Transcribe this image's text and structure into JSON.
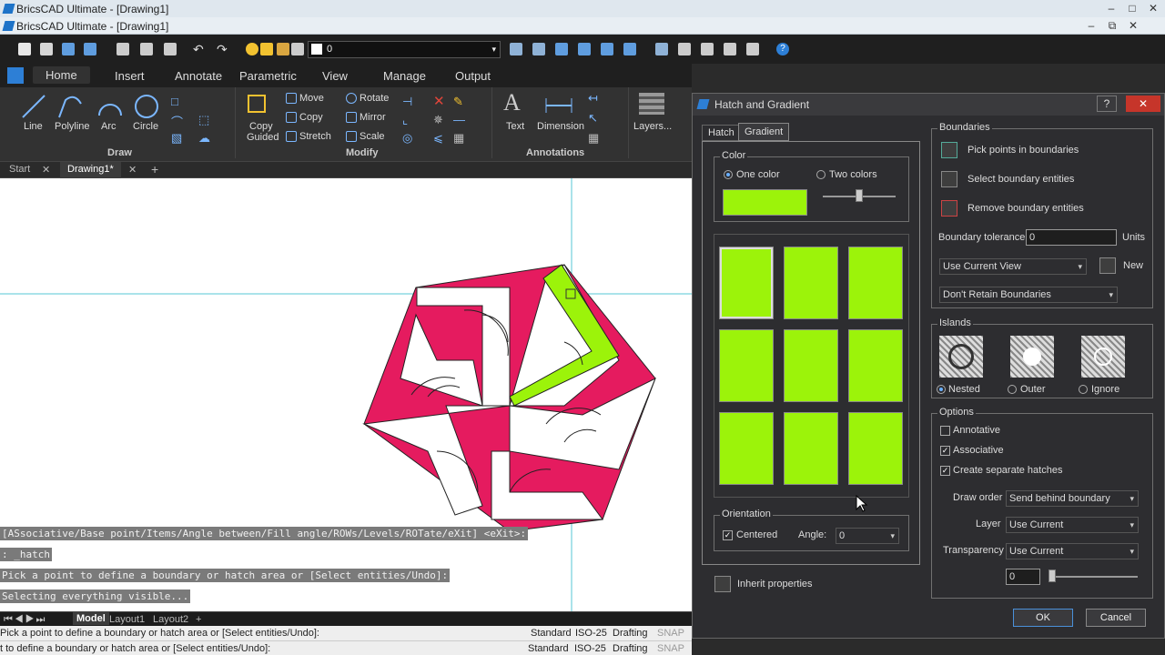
{
  "window": {
    "title": "BricsCAD Ultimate - [Drawing1]",
    "title2": "BricsCAD Ultimate - [Drawing1]"
  },
  "qat": {
    "layer_value": "0"
  },
  "ribbon": {
    "tabs": [
      "Home",
      "Insert",
      "Annotate",
      "Parametric",
      "View",
      "Manage",
      "Output"
    ],
    "draw": {
      "line": "Line",
      "polyline": "Polyline",
      "arc": "Arc",
      "circle": "Circle",
      "group": "Draw"
    },
    "modify": {
      "move": "Move",
      "copy": "Copy",
      "stretch": "Stretch",
      "copy_guided_1": "Copy",
      "copy_guided_2": "Guided",
      "rotate": "Rotate",
      "mirror": "Mirror",
      "scale": "Scale",
      "group": "Modify"
    },
    "annotations": {
      "text": "Text",
      "dimension": "Dimension",
      "group": "Annotations"
    },
    "layers": {
      "label": "Layers..."
    }
  },
  "doc_tabs": {
    "start": "Start",
    "drawing": "Drawing1*",
    "add": "+"
  },
  "command_lines": [
    "[ASsociative/Base point/Items/Angle between/Fill angle/ROWs/Levels/ROTate/eXit] <eXit>:",
    ": _hatch",
    "Pick a point to define a boundary or hatch area or [Select entities/Undo]:",
    "Selecting everything visible..."
  ],
  "layout_tabs": {
    "model": "Model",
    "layout1": "Layout1",
    "layout2": "Layout2",
    "add": "+"
  },
  "status": {
    "prompt1": "Pick a point to define a boundary or hatch area or [Select entities/Undo]:",
    "prompt2": "t to define a boundary or hatch area or [Select entities/Undo]:",
    "standard": "Standard",
    "iso": "ISO-25",
    "drafting": "Drafting",
    "snap": "SNAP"
  },
  "dialog": {
    "title": "Hatch and Gradient",
    "help": "?",
    "close": "✕",
    "tabs": [
      "Hatch",
      "Gradient"
    ],
    "color": {
      "label": "Color",
      "one_color": "One color",
      "two_colors": "Two colors",
      "swatch_color": "#9cf30a"
    },
    "orientation": {
      "label": "Orientation",
      "centered": "Centered",
      "angle_label": "Angle:",
      "angle_value": "0"
    },
    "inherit": "Inherit properties",
    "boundaries": {
      "label": "Boundaries",
      "pick_points": "Pick points in boundaries",
      "select_entities": "Select boundary entities",
      "remove_entities": "Remove boundary entities",
      "tolerance_label": "Boundary tolerance",
      "tolerance_value": "0",
      "units": "Units",
      "view": "Use Current View",
      "new": "New",
      "retain": "Don't Retain Boundaries"
    },
    "islands": {
      "label": "Islands",
      "nested": "Nested",
      "outer": "Outer",
      "ignore": "Ignore"
    },
    "options": {
      "label": "Options",
      "annotative": "Annotative",
      "associative": "Associative",
      "separate": "Create separate hatches",
      "draw_order_label": "Draw order",
      "draw_order": "Send behind boundary",
      "layer_label": "Layer",
      "layer": "Use Current",
      "transparency_label": "Transparency",
      "transparency": "Use Current",
      "transparency_value": "0"
    },
    "ok": "OK",
    "cancel": "Cancel"
  }
}
